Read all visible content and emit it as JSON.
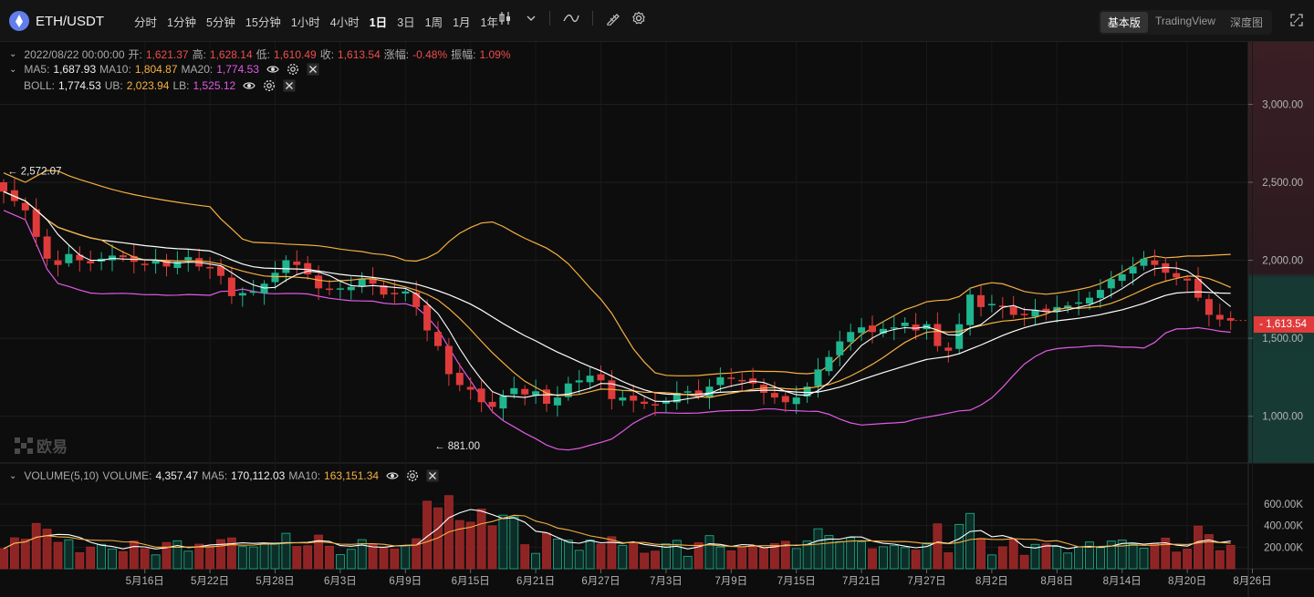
{
  "pair": {
    "symbol": "ETH/USDT",
    "icon": "eth-icon",
    "brand_color": "#627eea"
  },
  "intervals": [
    {
      "label": "分时",
      "active": false
    },
    {
      "label": "1分钟",
      "active": false
    },
    {
      "label": "5分钟",
      "active": false
    },
    {
      "label": "15分钟",
      "active": false
    },
    {
      "label": "1小时",
      "active": false
    },
    {
      "label": "4小时",
      "active": false
    },
    {
      "label": "1日",
      "active": true
    },
    {
      "label": "3日",
      "active": false
    },
    {
      "label": "1周",
      "active": false
    },
    {
      "label": "1月",
      "active": false
    },
    {
      "label": "1年",
      "active": false
    }
  ],
  "views": [
    {
      "label": "基本版",
      "active": true
    },
    {
      "label": "TradingView",
      "active": false
    },
    {
      "label": "深度图",
      "active": false
    }
  ],
  "ohlc": {
    "date": "2022/08/22 00:00:00",
    "open_k": "开:",
    "open": "1,621.37",
    "high_k": "高:",
    "high": "1,628.14",
    "low_k": "低:",
    "low": "1,610.49",
    "close_k": "收:",
    "close": "1,613.54",
    "change_k": "涨幅:",
    "change": "-0.48%",
    "amp_k": "振幅:",
    "amp": "1.09%"
  },
  "ma": {
    "ma5_k": "MA5:",
    "ma5": "1,687.93",
    "ma10_k": "MA10:",
    "ma10": "1,804.87",
    "ma20_k": "MA20:",
    "ma20": "1,774.53"
  },
  "boll": {
    "boll_k": "BOLL:",
    "boll": "1,774.53",
    "ub_k": "UB:",
    "ub": "2,023.94",
    "lb_k": "LB:",
    "lb": "1,525.12"
  },
  "volume_legend": {
    "title": "VOLUME(5,10)",
    "vol_k": "VOLUME:",
    "vol": "4,357.47",
    "ma5_k": "MA5:",
    "ma5": "170,112.03",
    "ma10_k": "MA10:",
    "ma10": "163,151.34"
  },
  "last_price": "1,613.54",
  "watermark": "欧易",
  "colors": {
    "up": "#1fb58f",
    "down": "#e03b3b",
    "ma_white": "#ffffff",
    "ma_orange": "#f5b041",
    "boll_magenta": "#e25ae6",
    "background": "#0d0d0d"
  },
  "chart_data": {
    "type": "candlestick",
    "y_ticks": [
      "3,000.00",
      "2,500.00",
      "2,000.00",
      "1,500.00",
      "1,000.00"
    ],
    "y_tick_values": [
      3000,
      2500,
      2000,
      1500,
      1000
    ],
    "ylim": [
      700,
      3400
    ],
    "volume_ticks": [
      "600.00K",
      "400.00K",
      "200.00K"
    ],
    "volume_tick_values": [
      600000,
      400000,
      200000
    ],
    "volume_ylim": [
      0,
      760000
    ],
    "x_ticks": [
      "5月16日",
      "5月22日",
      "5月28日",
      "6月3日",
      "6月9日",
      "6月15日",
      "6月21日",
      "6月27日",
      "7月3日",
      "7月9日",
      "7月15日",
      "7月21日",
      "7月27日",
      "8月2日",
      "8月8日",
      "8月14日",
      "8月20日",
      "8月26日"
    ],
    "x_tick_day_index": [
      13,
      19,
      25,
      31,
      37,
      43,
      49,
      55,
      61,
      67,
      73,
      79,
      85,
      91,
      97,
      103,
      109,
      115
    ],
    "day_count": 110,
    "annotations": [
      {
        "label": "2,572.07",
        "price": 2572.07,
        "day": 0
      },
      {
        "label": "881.00",
        "price": 881.0,
        "day": 39
      }
    ],
    "close": [
      2440,
      2380,
      2320,
      2150,
      2010,
      1970,
      2040,
      2000,
      1980,
      2010,
      2030,
      2020,
      1990,
      1970,
      2000,
      1960,
      1990,
      2020,
      1960,
      1950,
      1900,
      1770,
      1790,
      1800,
      1850,
      1920,
      2000,
      1970,
      1910,
      1820,
      1810,
      1820,
      1830,
      1880,
      1850,
      1780,
      1790,
      1800,
      1700,
      1550,
      1450,
      1270,
      1200,
      1170,
      1090,
      1060,
      1130,
      1180,
      1140,
      1160,
      1080,
      1120,
      1210,
      1230,
      1260,
      1230,
      1110,
      1120,
      1100,
      1080,
      1070,
      1100,
      1150,
      1160,
      1130,
      1190,
      1250,
      1240,
      1230,
      1210,
      1150,
      1120,
      1090,
      1120,
      1190,
      1300,
      1380,
      1480,
      1540,
      1570,
      1540,
      1560,
      1570,
      1600,
      1550,
      1590,
      1450,
      1420,
      1590,
      1780,
      1700,
      1720,
      1700,
      1650,
      1650,
      1680,
      1670,
      1700,
      1710,
      1730,
      1760,
      1810,
      1880,
      1910,
      1960,
      2010,
      1970,
      1920,
      1890,
      1870,
      1760,
      1650,
      1620,
      1613
    ]
  }
}
